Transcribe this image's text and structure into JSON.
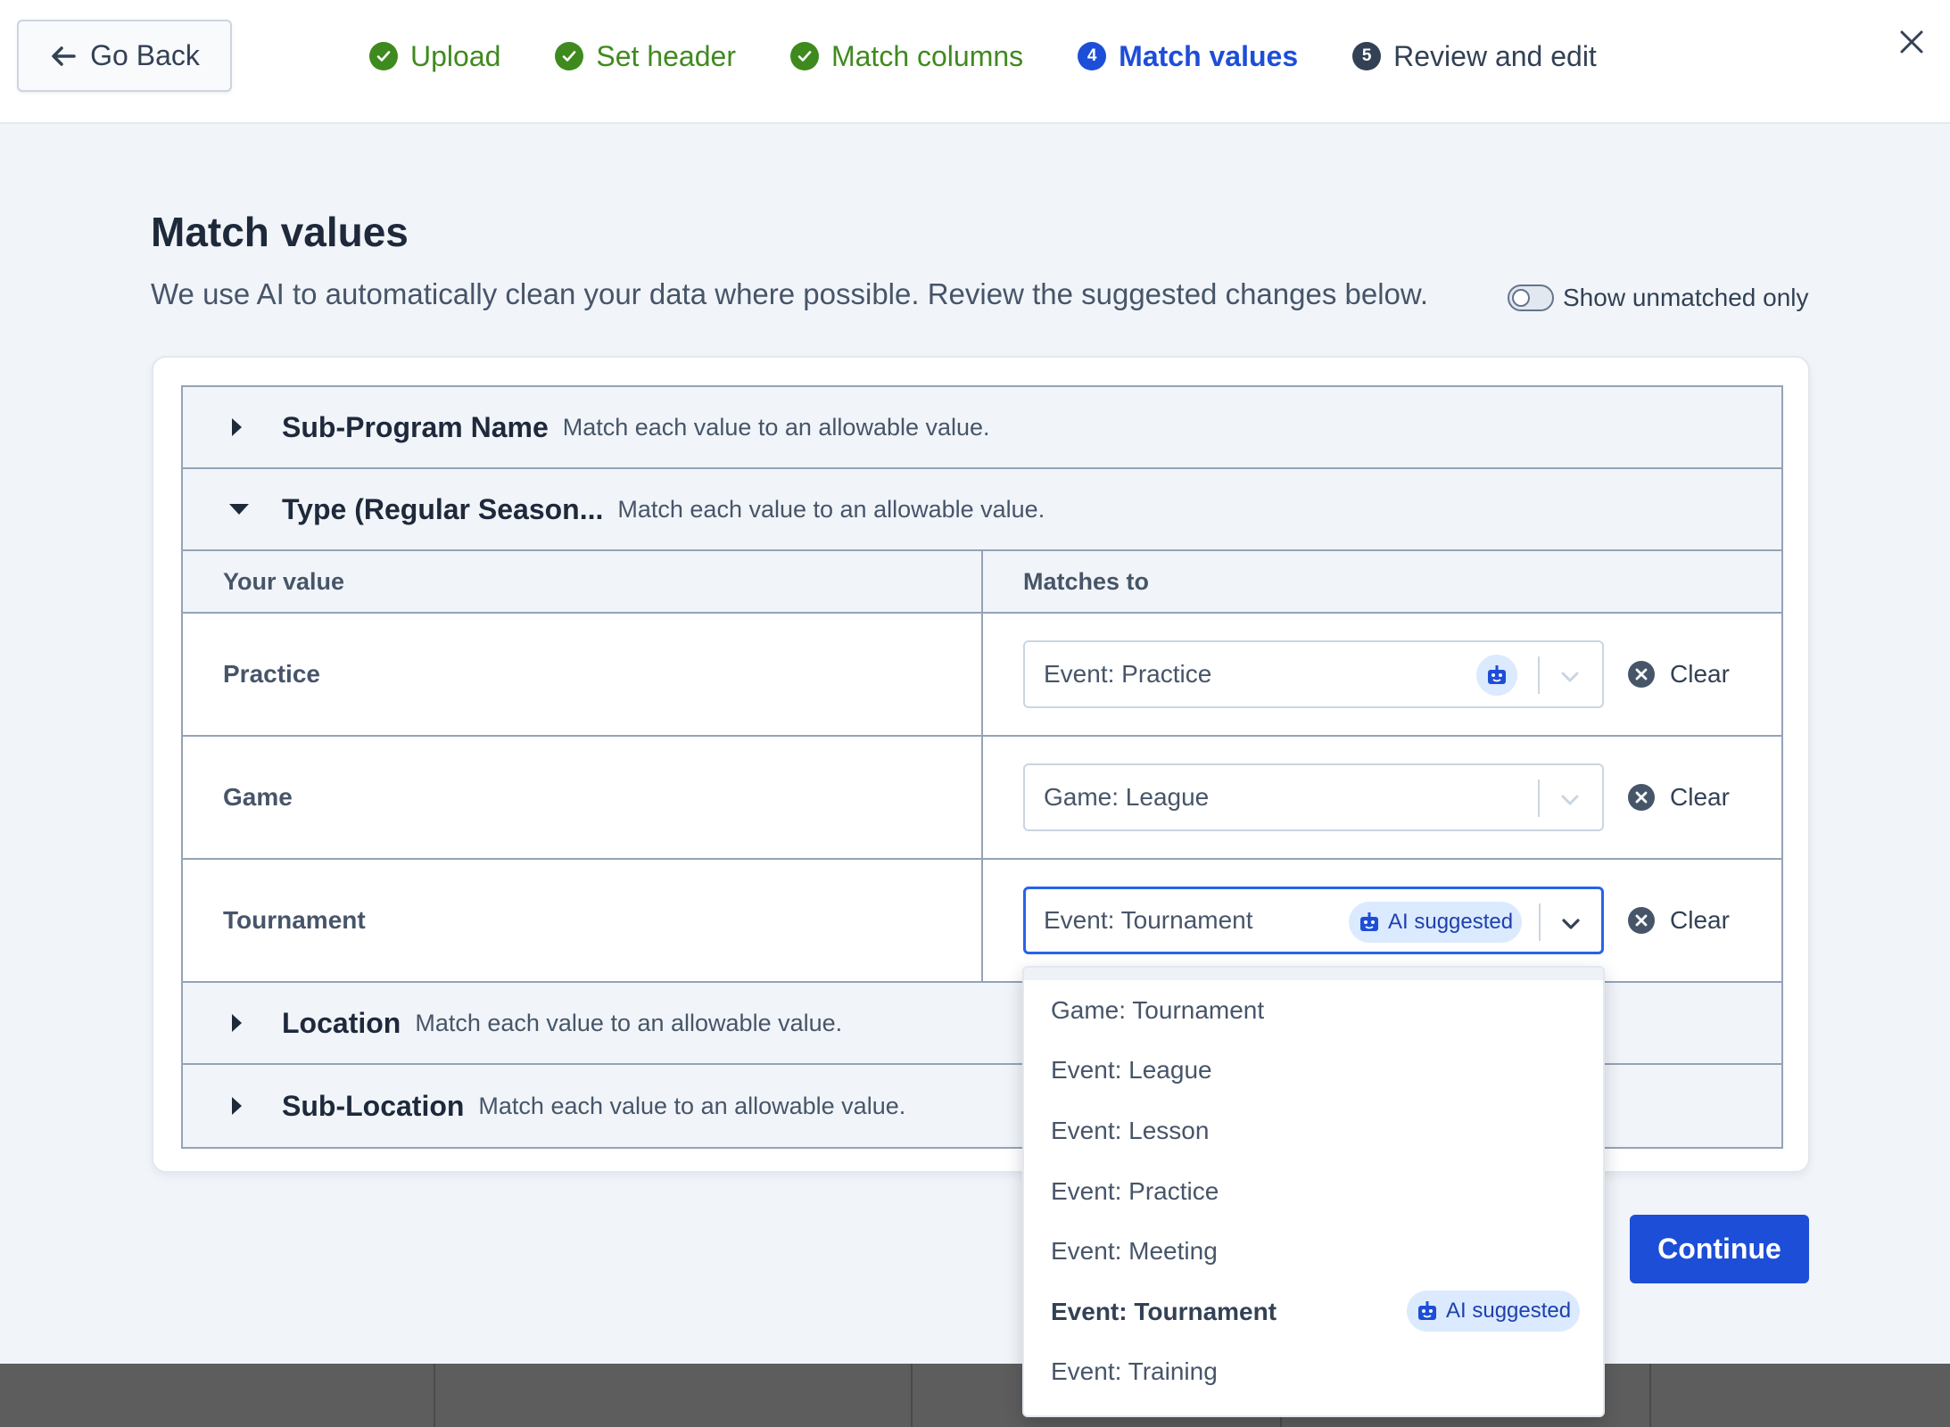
{
  "header": {
    "back_label": "Go Back",
    "steps": [
      {
        "num": "1",
        "label": "Upload",
        "state": "done"
      },
      {
        "num": "2",
        "label": "Set header",
        "state": "done"
      },
      {
        "num": "3",
        "label": "Match columns",
        "state": "done"
      },
      {
        "num": "4",
        "label": "Match values",
        "state": "active"
      },
      {
        "num": "5",
        "label": "Review and edit",
        "state": "todo"
      }
    ]
  },
  "main": {
    "title": "Match values",
    "subtitle": "We use AI to automatically clean your data where possible. Review the suggested changes below.",
    "toggle_label": "Show unmatched only",
    "toggle_on": false
  },
  "sections": [
    {
      "name": "Sub-Program Name",
      "desc": "Match each value to an allowable value.",
      "expanded": false
    },
    {
      "name": "Type (Regular Season...",
      "desc": "Match each value to an allowable value.",
      "expanded": true
    },
    {
      "name": "Location",
      "desc": "Match each value to an allowable value.",
      "expanded": false
    },
    {
      "name": "Sub-Location",
      "desc": "Match each value to an allowable value.",
      "expanded": false
    }
  ],
  "table": {
    "col_your_value": "Your value",
    "col_matches_to": "Matches to",
    "rows": [
      {
        "value": "Practice",
        "match": "Event: Practice",
        "ai": true
      },
      {
        "value": "Game",
        "match": "Game: League",
        "ai": false
      },
      {
        "value": "Tournament",
        "match": "Event: Tournament",
        "ai": true
      }
    ],
    "clear_label": "Clear",
    "ai_label": "AI suggested"
  },
  "dropdown": {
    "options": [
      "Game: Tournament",
      "Event: League",
      "Event: Lesson",
      "Event: Practice",
      "Event: Meeting",
      "Event: Tournament",
      "Event: Training"
    ],
    "selected": "Event: Tournament"
  },
  "footer": {
    "continue_label": "Continue"
  },
  "colors": {
    "accent": "#1d4ed8",
    "done": "#3f8a1e",
    "ai_bg": "#dbeafe"
  }
}
